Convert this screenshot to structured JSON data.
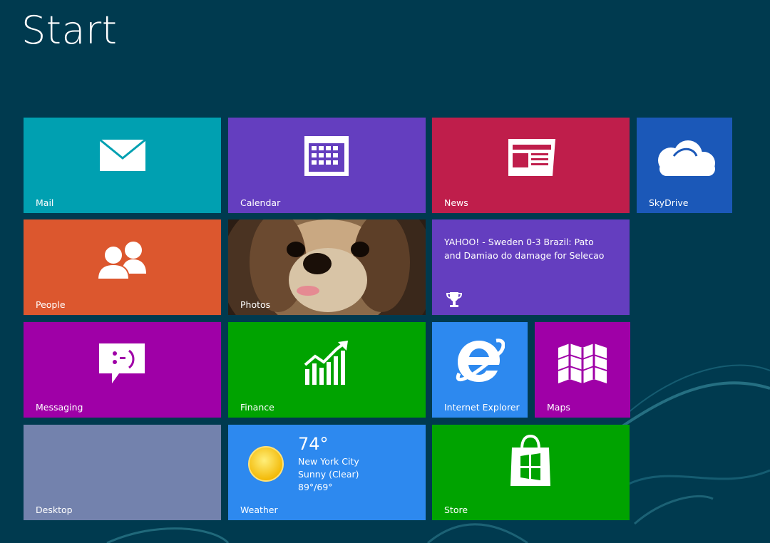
{
  "screen": {
    "title": "Start"
  },
  "colors": {
    "background": "#003a4f",
    "mail": "#00a0b1",
    "calendar": "#643ebf",
    "news": "#bf1e4b",
    "skydrive": "#1b58b8",
    "people": "#dc572e",
    "news_live": "#643ebf",
    "messaging": "#9f00a7",
    "finance": "#00a300",
    "internet_explorer": "#2d89ef",
    "maps": "#9f00a7",
    "desktop": "#7382ad",
    "weather": "#2d89ef",
    "store": "#00a300"
  },
  "tiles": {
    "mail": {
      "label": "Mail",
      "icon": "envelope-icon"
    },
    "calendar": {
      "label": "Calendar",
      "icon": "calendar-icon"
    },
    "news": {
      "label": "News",
      "icon": "newspaper-icon"
    },
    "skydrive": {
      "label": "SkyDrive",
      "icon": "cloud-icon"
    },
    "people": {
      "label": "People",
      "icon": "people-icon"
    },
    "photos": {
      "label": "Photos",
      "icon": "dog-photo"
    },
    "news_live": {
      "headline": "YAHOO! - Sweden 0-3 Brazil: Pato and Damiao do damage for Selecao",
      "icon": "trophy-icon"
    },
    "messaging": {
      "label": "Messaging",
      "icon": "chat-smiley-icon"
    },
    "finance": {
      "label": "Finance",
      "icon": "chart-arrow-icon"
    },
    "internet_explorer": {
      "label": "Internet Explorer",
      "icon": "ie-logo-icon"
    },
    "maps": {
      "label": "Maps",
      "icon": "folded-map-icon"
    },
    "desktop": {
      "label": "Desktop"
    },
    "weather": {
      "label": "Weather",
      "temperature": "74°",
      "city": "New York City",
      "condition": "Sunny (Clear)",
      "high_low": "89°/69°",
      "icon": "sun-icon"
    },
    "store": {
      "label": "Store",
      "icon": "shopping-bag-icon"
    }
  }
}
